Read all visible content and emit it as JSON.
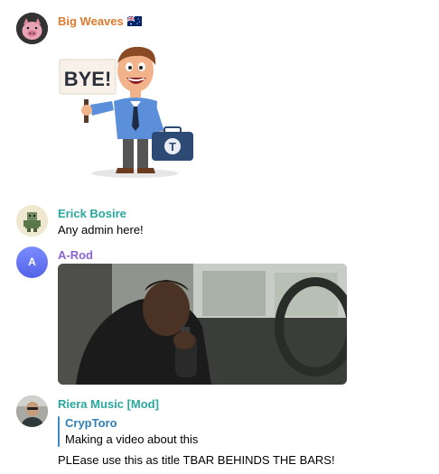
{
  "colors": {
    "big_weaves": "#e07b2e",
    "erick": "#2aa8a0",
    "arod": "#8a63d2",
    "riera": "#2aa8a0",
    "reply_accent": "#3a88c9",
    "reply_name": "#2f7fb8"
  },
  "messages": [
    {
      "author": "Big Weaves",
      "flag_icon": "australia-flag-icon",
      "avatar_icon": "pig-avatar-icon",
      "sticker": {
        "sign_text": "BYE!",
        "icon": "businessman-bye-sticker",
        "briefcase_letter": "T"
      }
    },
    {
      "author": "Erick Bosire",
      "avatar_icon": "robot-avatar-icon",
      "text": "Any admin here!"
    },
    {
      "author": "A-Rod",
      "avatar_letter": "A",
      "media_icon": "video-gif-thumbnail"
    },
    {
      "author": "Riera Music [Mod]",
      "avatar_icon": "person-photo-avatar-icon",
      "reply": {
        "author": "CrypToro",
        "text": "Making a video about this"
      },
      "text": "PLEase use this as title TBAR BEHINDS THE BARS!"
    }
  ]
}
